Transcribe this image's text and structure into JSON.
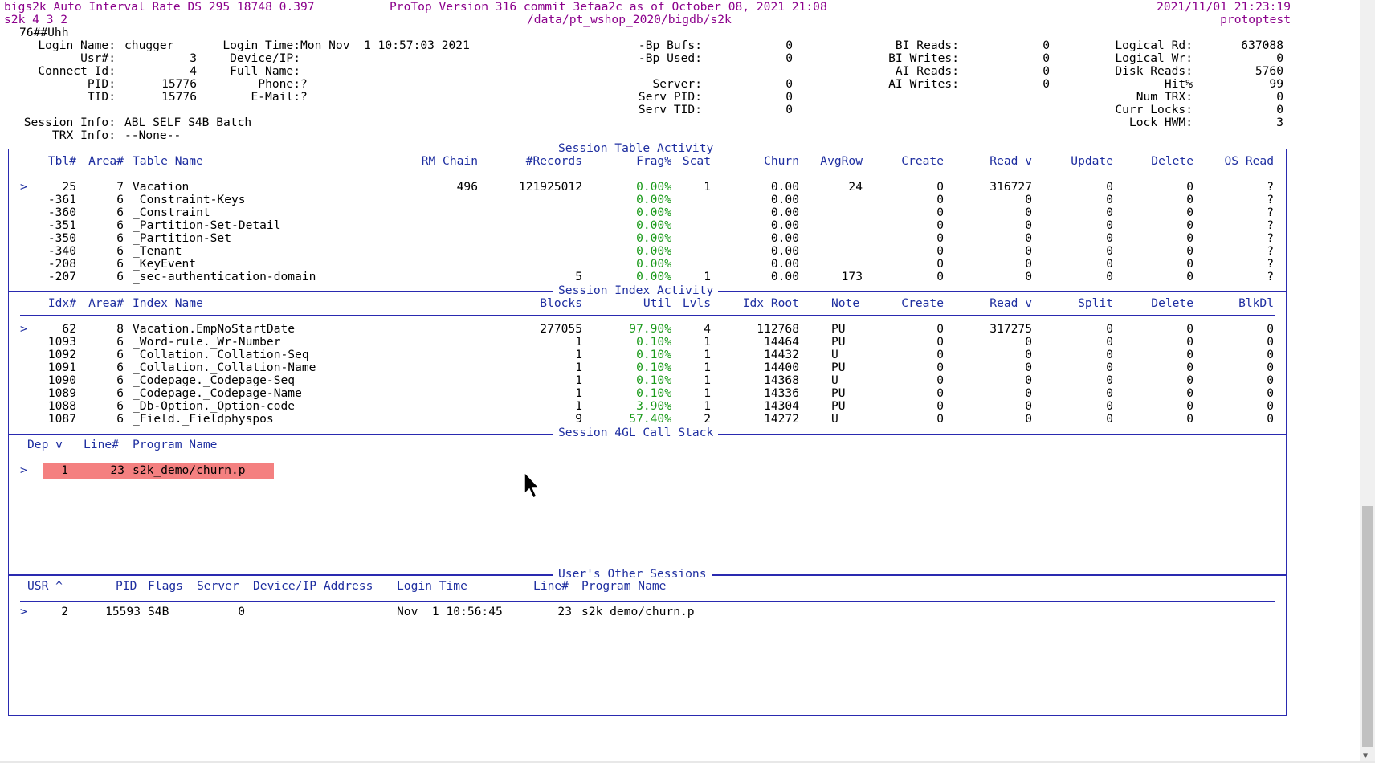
{
  "header": {
    "left1": "bigs2k Auto Interval Rate DS 295 18748 0.397",
    "center1": "ProTop Version 316 commit 3efaa2c as of October 08, 2021 21:08",
    "datetime": "2021/11/01 21:23:19",
    "left2": "s2k 4 3 2",
    "path": "/data/pt_wshop_2020/bigdb/s2k",
    "host": "protoptest",
    "input_line": "76##Uhh"
  },
  "user_info": {
    "login_name_label": "Login Name:",
    "login_name": "chugger",
    "usr_label": "Usr#:",
    "usr": "3",
    "connect_label": "Connect Id:",
    "connect": "4",
    "pid_label": "PID:",
    "pid": "15776",
    "tid_label": "TID:",
    "tid": "15776",
    "login_time_label": "Login Time:",
    "login_time": "Mon Nov  1 10:57:03 2021",
    "device_label": "Device/IP:",
    "device": "",
    "fullname_label": "Full Name:",
    "fullname": "",
    "phone_label": "Phone:",
    "phone": "?",
    "email_label": "E-Mail:",
    "email": "?",
    "session_info_label": "Session Info:",
    "session_info": "ABL SELF S4B Batch",
    "trx_info_label": "TRX Info:",
    "trx_info": "--None--"
  },
  "stats_mid": [
    {
      "label": "-Bp Bufs:",
      "value": "0"
    },
    {
      "label": "-Bp Used:",
      "value": "0"
    },
    {
      "label": "Server:",
      "value": "0"
    },
    {
      "label": "Serv PID:",
      "value": "0"
    },
    {
      "label": "Serv TID:",
      "value": "0"
    }
  ],
  "stats_bi": [
    {
      "label": "BI Reads:",
      "value": "0"
    },
    {
      "label": "BI Writes:",
      "value": "0"
    },
    {
      "label": "AI Reads:",
      "value": "0"
    },
    {
      "label": "AI Writes:",
      "value": "0"
    }
  ],
  "stats_right": [
    {
      "label": "Logical Rd:",
      "value": "637088"
    },
    {
      "label": "Logical Wr:",
      "value": "0"
    },
    {
      "label": "Disk Reads:",
      "value": "5760"
    },
    {
      "label": "Hit%",
      "value": "99"
    },
    {
      "label": "Num TRX:",
      "value": "0"
    },
    {
      "label": "Curr Locks:",
      "value": "0"
    },
    {
      "label": "Lock HWM:",
      "value": "3"
    }
  ],
  "table_activity": {
    "title": "Session Table Activity",
    "headers": [
      "Tbl#",
      "Area#",
      "Table Name",
      "RM Chain",
      "#Records",
      "Frag%",
      "Scat",
      "Churn",
      "AvgRow",
      "Create",
      "Read v",
      "Update",
      "Delete",
      "OS Read"
    ],
    "rows": [
      {
        "sel": ">",
        "tbl": "25",
        "area": "7",
        "name": "Vacation",
        "rm": "496",
        "records": "121925012",
        "frag": "0.00%",
        "scat": "1",
        "churn": "0.00",
        "avgrow": "24",
        "create": "0",
        "read": "316727",
        "update": "0",
        "delete": "0",
        "osread": "?"
      },
      {
        "sel": "",
        "tbl": "-361",
        "area": "6",
        "name": "_Constraint-Keys",
        "rm": "",
        "records": "",
        "frag": "0.00%",
        "scat": "",
        "churn": "0.00",
        "avgrow": "",
        "create": "0",
        "read": "0",
        "update": "0",
        "delete": "0",
        "osread": "?"
      },
      {
        "sel": "",
        "tbl": "-360",
        "area": "6",
        "name": "_Constraint",
        "rm": "",
        "records": "",
        "frag": "0.00%",
        "scat": "",
        "churn": "0.00",
        "avgrow": "",
        "create": "0",
        "read": "0",
        "update": "0",
        "delete": "0",
        "osread": "?"
      },
      {
        "sel": "",
        "tbl": "-351",
        "area": "6",
        "name": "_Partition-Set-Detail",
        "rm": "",
        "records": "",
        "frag": "0.00%",
        "scat": "",
        "churn": "0.00",
        "avgrow": "",
        "create": "0",
        "read": "0",
        "update": "0",
        "delete": "0",
        "osread": "?"
      },
      {
        "sel": "",
        "tbl": "-350",
        "area": "6",
        "name": "_Partition-Set",
        "rm": "",
        "records": "",
        "frag": "0.00%",
        "scat": "",
        "churn": "0.00",
        "avgrow": "",
        "create": "0",
        "read": "0",
        "update": "0",
        "delete": "0",
        "osread": "?"
      },
      {
        "sel": "",
        "tbl": "-340",
        "area": "6",
        "name": "_Tenant",
        "rm": "",
        "records": "",
        "frag": "0.00%",
        "scat": "",
        "churn": "0.00",
        "avgrow": "",
        "create": "0",
        "read": "0",
        "update": "0",
        "delete": "0",
        "osread": "?"
      },
      {
        "sel": "",
        "tbl": "-208",
        "area": "6",
        "name": "_KeyEvent",
        "rm": "",
        "records": "",
        "frag": "0.00%",
        "scat": "",
        "churn": "0.00",
        "avgrow": "",
        "create": "0",
        "read": "0",
        "update": "0",
        "delete": "0",
        "osread": "?"
      },
      {
        "sel": "",
        "tbl": "-207",
        "area": "6",
        "name": "_sec-authentication-domain",
        "rm": "",
        "records": "5",
        "frag": "0.00%",
        "scat": "1",
        "churn": "0.00",
        "avgrow": "173",
        "create": "0",
        "read": "0",
        "update": "0",
        "delete": "0",
        "osread": "?"
      }
    ]
  },
  "index_activity": {
    "title": "Session Index Activity",
    "headers": [
      "Idx#",
      "Area#",
      "Index Name",
      "Blocks",
      "Util",
      "Lvls",
      "Idx Root",
      "Note",
      "Create",
      "Read v",
      "Split",
      "Delete",
      "BlkDl"
    ],
    "rows": [
      {
        "sel": ">",
        "idx": "62",
        "area": "8",
        "name": "Vacation.EmpNoStartDate",
        "blocks": "277055",
        "util": "97.90%",
        "lvls": "4",
        "root": "112768",
        "note": "PU",
        "create": "0",
        "read": "317275",
        "split": "0",
        "delete": "0",
        "blkdl": "0"
      },
      {
        "sel": "",
        "idx": "1093",
        "area": "6",
        "name": "_Word-rule._Wr-Number",
        "blocks": "1",
        "util": "0.10%",
        "lvls": "1",
        "root": "14464",
        "note": "PU",
        "create": "0",
        "read": "0",
        "split": "0",
        "delete": "0",
        "blkdl": "0"
      },
      {
        "sel": "",
        "idx": "1092",
        "area": "6",
        "name": "_Collation._Collation-Seq",
        "blocks": "1",
        "util": "0.10%",
        "lvls": "1",
        "root": "14432",
        "note": "U",
        "create": "0",
        "read": "0",
        "split": "0",
        "delete": "0",
        "blkdl": "0"
      },
      {
        "sel": "",
        "idx": "1091",
        "area": "6",
        "name": "_Collation._Collation-Name",
        "blocks": "1",
        "util": "0.10%",
        "lvls": "1",
        "root": "14400",
        "note": "PU",
        "create": "0",
        "read": "0",
        "split": "0",
        "delete": "0",
        "blkdl": "0"
      },
      {
        "sel": "",
        "idx": "1090",
        "area": "6",
        "name": "_Codepage._Codepage-Seq",
        "blocks": "1",
        "util": "0.10%",
        "lvls": "1",
        "root": "14368",
        "note": "U",
        "create": "0",
        "read": "0",
        "split": "0",
        "delete": "0",
        "blkdl": "0"
      },
      {
        "sel": "",
        "idx": "1089",
        "area": "6",
        "name": "_Codepage._Codepage-Name",
        "blocks": "1",
        "util": "0.10%",
        "lvls": "1",
        "root": "14336",
        "note": "PU",
        "create": "0",
        "read": "0",
        "split": "0",
        "delete": "0",
        "blkdl": "0"
      },
      {
        "sel": "",
        "idx": "1088",
        "area": "6",
        "name": "_Db-Option._Option-code",
        "blocks": "1",
        "util": "3.90%",
        "lvls": "1",
        "root": "14304",
        "note": "PU",
        "create": "0",
        "read": "0",
        "split": "0",
        "delete": "0",
        "blkdl": "0"
      },
      {
        "sel": "",
        "idx": "1087",
        "area": "6",
        "name": "_Field._Fieldphyspos",
        "blocks": "9",
        "util": "57.40%",
        "lvls": "2",
        "root": "14272",
        "note": "U",
        "create": "0",
        "read": "0",
        "split": "0",
        "delete": "0",
        "blkdl": "0"
      }
    ]
  },
  "call_stack": {
    "title": "Session 4GL Call Stack",
    "headers": [
      "Dep v",
      "Line#",
      "Program Name"
    ],
    "rows": [
      {
        "sel": ">",
        "dep": "1",
        "line": "23",
        "program": "s2k_demo/churn.p"
      }
    ]
  },
  "other_sessions": {
    "title": "User's Other Sessions",
    "headers": [
      "USR ^",
      "PID",
      "Flags",
      "Server",
      "Device/IP Address",
      "Login Time",
      "Line#",
      "Program Name"
    ],
    "rows": [
      {
        "sel": ">",
        "usr": "2",
        "pid": "15593",
        "flags": "S4B",
        "server": "0",
        "device": "",
        "login_time": "Nov  1 10:56:45",
        "line": "23",
        "program": "s2k_demo/churn.p"
      }
    ]
  },
  "colors": {
    "magenta": "#8b008b",
    "blue": "#1e2ea0",
    "green": "#1a9a1a",
    "highlight": "#f48080"
  }
}
